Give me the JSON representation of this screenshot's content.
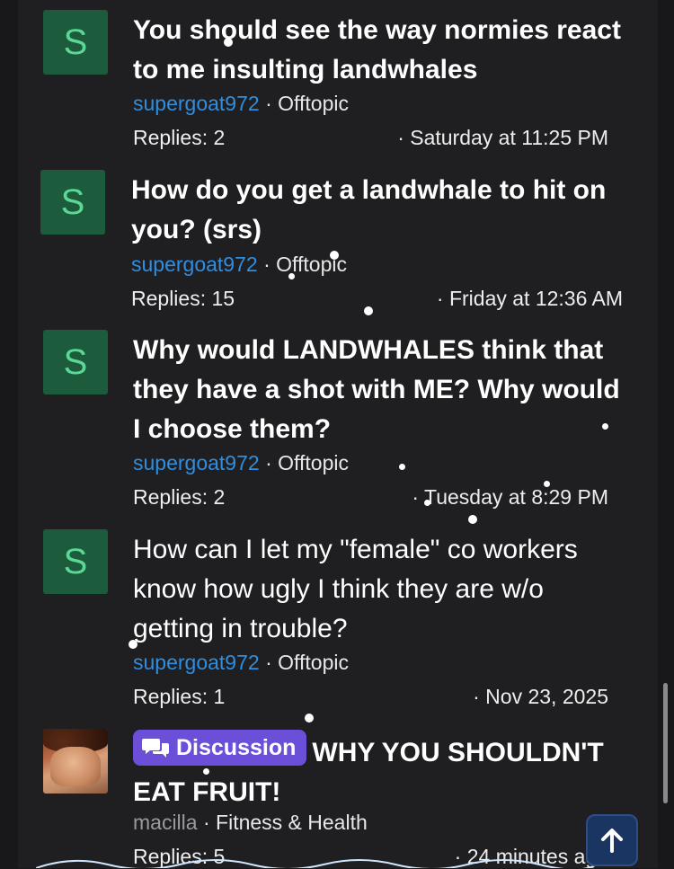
{
  "threads": [
    {
      "avatar_letter": "S",
      "title": "You should see the way normies react to me insulting landwhales",
      "author": "supergoat972",
      "separator": "·",
      "forum": "Offtopic",
      "replies": "Replies: 2",
      "date": "· Saturday at 11:25 PM"
    },
    {
      "avatar_letter": "S",
      "title": "How do you get a landwhale to hit on you? (srs)",
      "author": "supergoat972",
      "separator": "·",
      "forum": "Offtopic",
      "replies": "Replies: 15",
      "date": "· Friday at 12:36 AM"
    },
    {
      "avatar_letter": "S",
      "title": "Why would LANDWHALES think that they have a shot with ME? Why would I choose them?",
      "author": "supergoat972",
      "separator": "·",
      "forum": "Offtopic",
      "replies": "Replies: 2",
      "date": "· Tuesday at 8:29 PM"
    },
    {
      "avatar_letter": "S",
      "title": "How can I let my \"female\" co workers know how ugly I think they are w/o getting in trouble?",
      "author": "supergoat972",
      "separator": "·",
      "forum": "Offtopic",
      "replies": "Replies: 1",
      "date": "· Nov 23, 2025"
    },
    {
      "badge": "Discussion",
      "title": "WHY YOU SHOULDN'T EAT FRUIT!",
      "author": "macilla",
      "separator": "·",
      "forum": "Fitness & Health",
      "replies": "Replies: 5",
      "date": "· 24 minutes ago"
    }
  ],
  "colors": {
    "background": "#1f1f21",
    "avatar_bg": "#1c5c3c",
    "avatar_letter": "#5cd896",
    "author_link": "#2f8ee0",
    "badge_bg": "#6b4fd8",
    "fab_bg": "#1b3563"
  },
  "icons": {
    "badge_icon": "chat-bubbles-icon",
    "fab_icon": "arrow-up-icon"
  }
}
